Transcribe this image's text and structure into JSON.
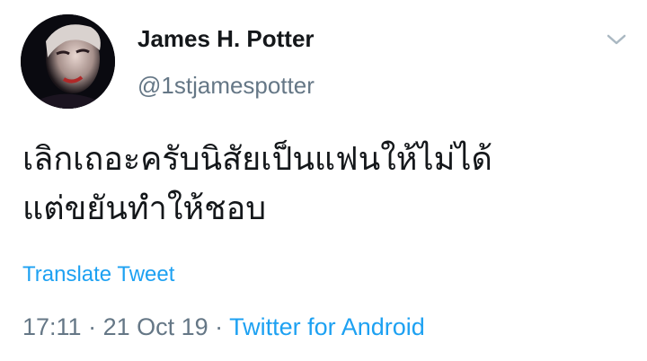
{
  "user": {
    "display_name": "James H. Potter",
    "handle": "@1stjamespotter",
    "avatar_icon": "profile-photo"
  },
  "menu": {
    "icon": "chevron-down-icon"
  },
  "tweet": {
    "lines": [
      "เลิกเถอะครับนิสัยเป็นแฟนให้ไม่ได้",
      "แต่ขยันทำให้ชอบ"
    ],
    "translate_label": "Translate Tweet"
  },
  "meta": {
    "time": "17:11",
    "separator": " · ",
    "date": "21 Oct 19",
    "source": "Twitter for Android"
  },
  "colors": {
    "link": "#1da1f2",
    "muted": "#657786",
    "text": "#14171a"
  }
}
